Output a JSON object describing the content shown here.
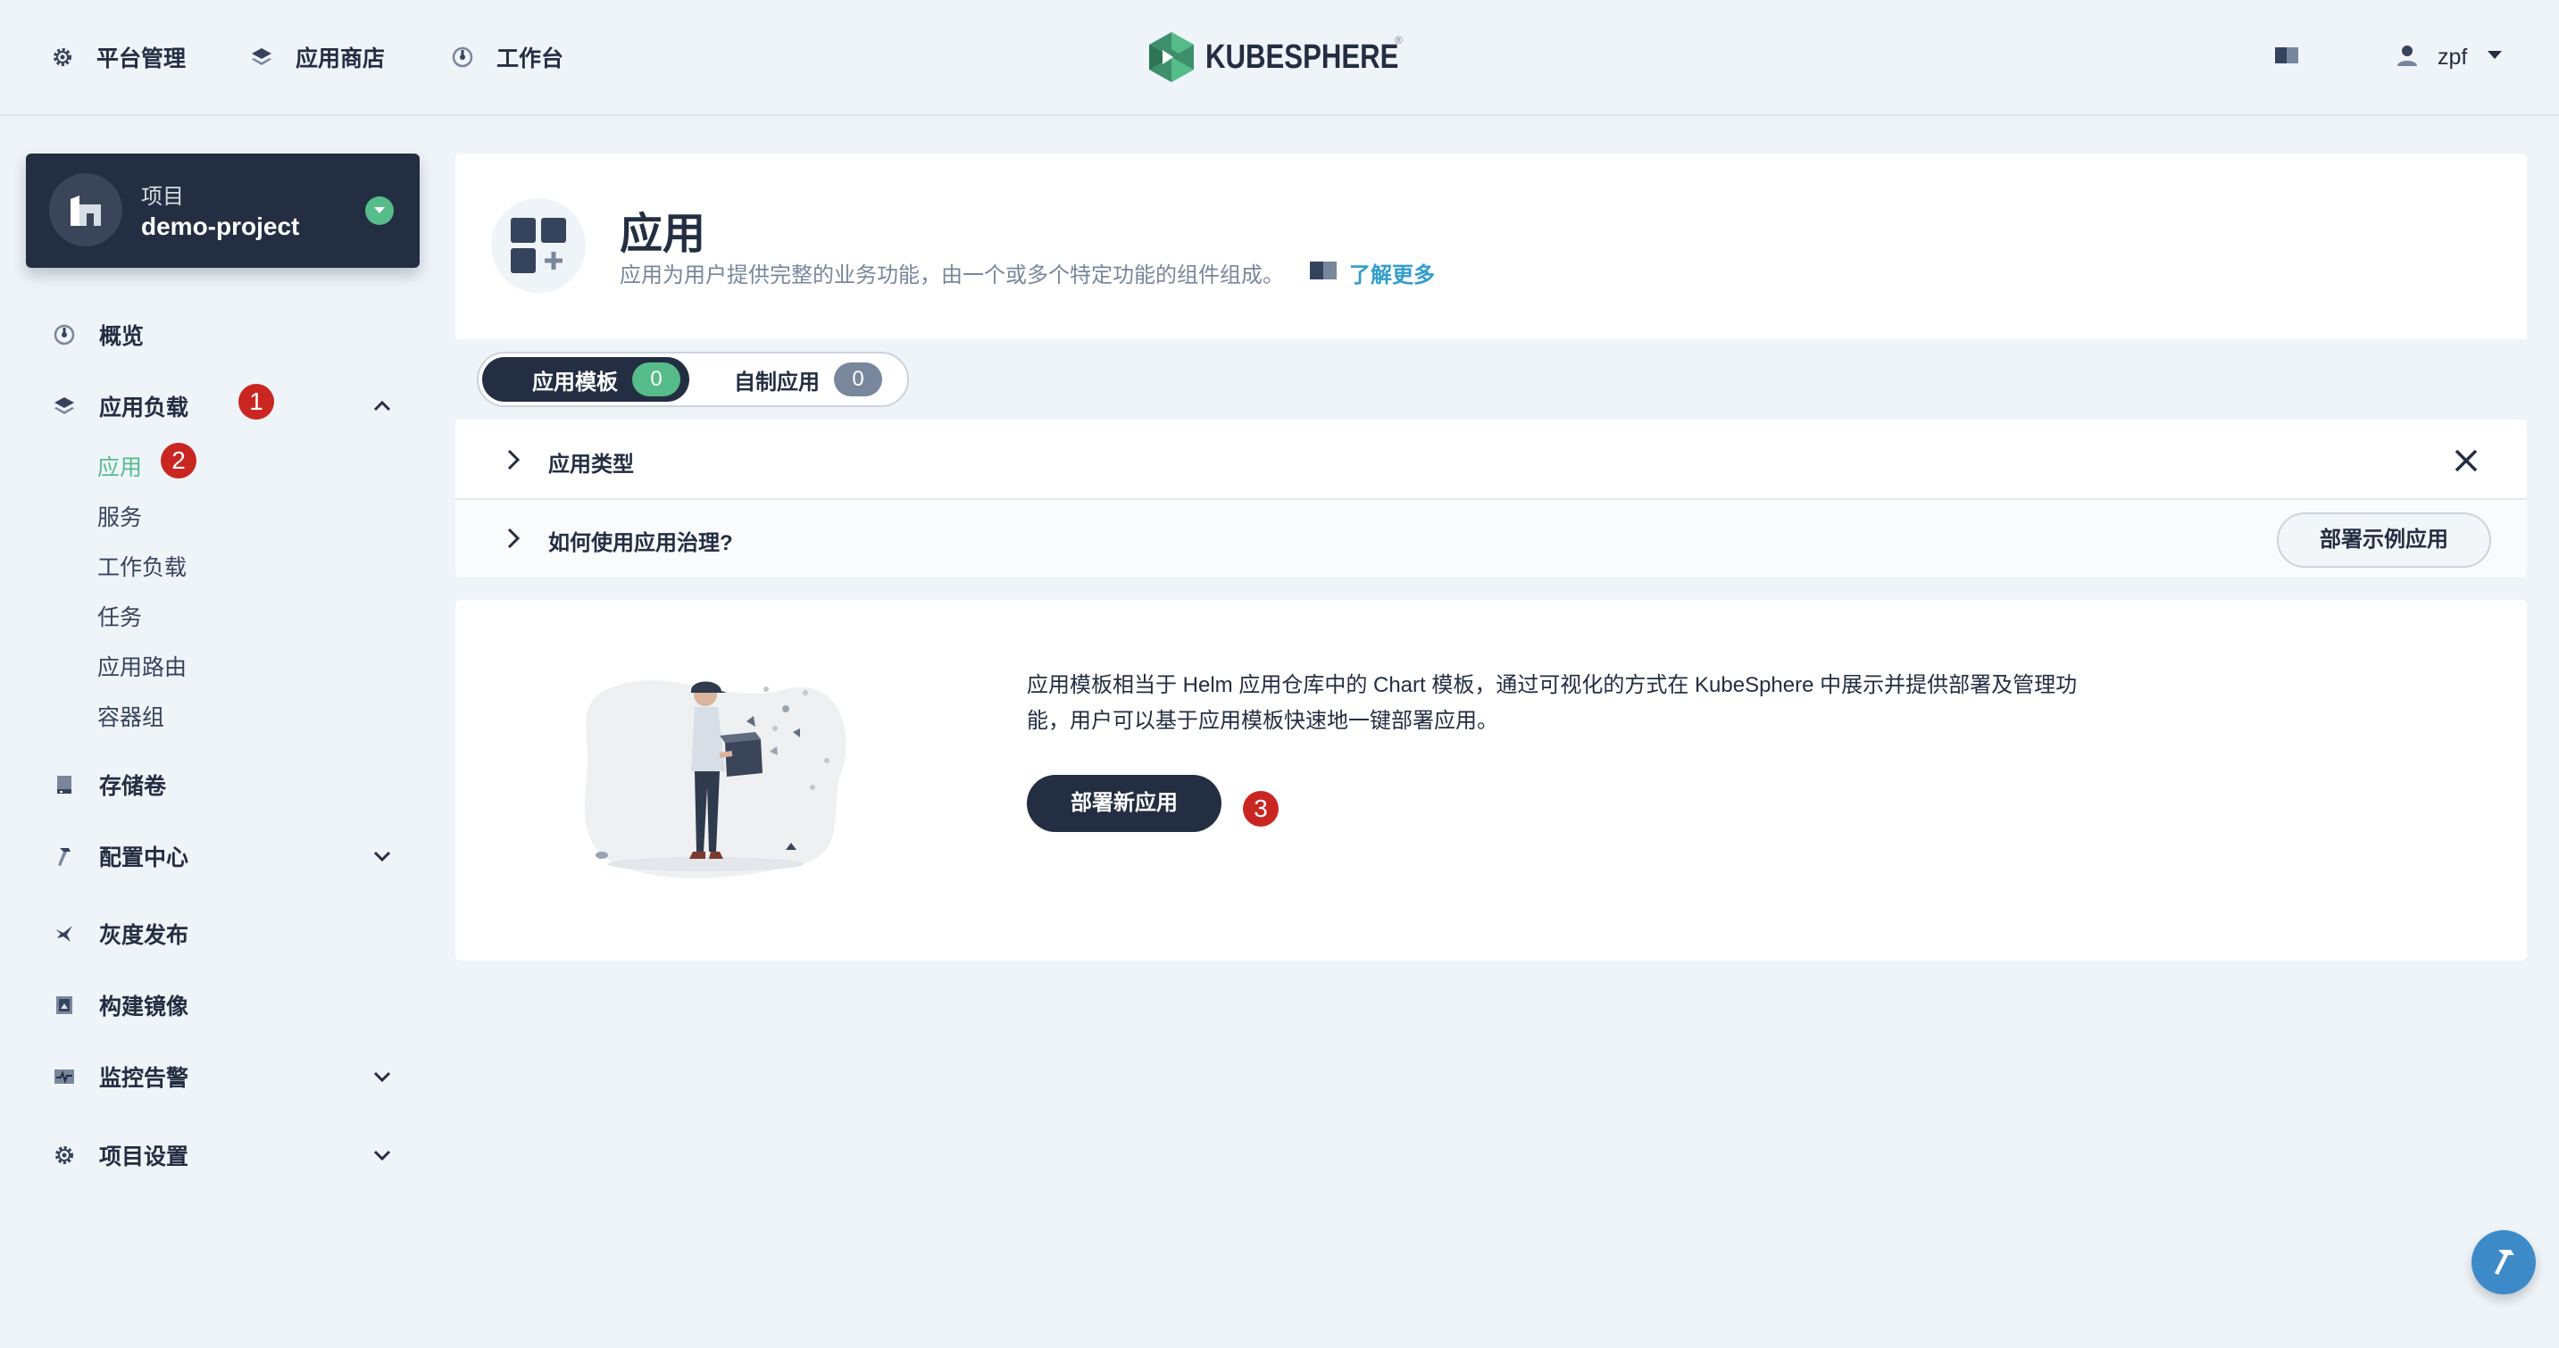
{
  "topbar": {
    "nav": [
      {
        "label": "平台管理",
        "icon": "gear-icon"
      },
      {
        "label": "应用商店",
        "icon": "layers-icon"
      },
      {
        "label": "工作台",
        "icon": "dashboard-icon"
      }
    ],
    "logo_text": "KUBESPHERE",
    "logo_mark": "®",
    "user": {
      "name": "zpf"
    }
  },
  "project": {
    "kind_label": "项目",
    "name": "demo-project"
  },
  "sidebar": {
    "items": [
      {
        "label": "概览",
        "icon": "dashboard-icon"
      },
      {
        "label": "应用负载",
        "icon": "layers-icon",
        "expanded": true,
        "children": [
          "应用",
          "服务",
          "工作负载",
          "任务",
          "应用路由",
          "容器组"
        ]
      },
      {
        "label": "存储卷",
        "icon": "storage-icon"
      },
      {
        "label": "配置中心",
        "icon": "hammer-icon"
      },
      {
        "label": "灰度发布",
        "icon": "bird-icon"
      },
      {
        "label": "构建镜像",
        "icon": "image-build-icon"
      },
      {
        "label": "监控告警",
        "icon": "monitor-icon"
      },
      {
        "label": "项目设置",
        "icon": "gear-icon"
      }
    ],
    "active_child": "应用"
  },
  "annotations": {
    "step1": "1",
    "step2": "2",
    "step3": "3"
  },
  "header": {
    "title": "应用",
    "description": "应用为用户提供完整的业务功能，由一个或多个特定功能的组件组成。",
    "learn_more": "了解更多"
  },
  "tabs": [
    {
      "label": "应用模板",
      "count": "0",
      "active": true
    },
    {
      "label": "自制应用",
      "count": "0",
      "active": false
    }
  ],
  "info_rows": {
    "app_type": "应用类型",
    "how_to": "如何使用应用治理?",
    "demo_button": "部署示例应用"
  },
  "empty_state": {
    "text": "应用模板相当于 Helm 应用仓库中的 Chart 模板，通过可视化的方式在 KubeSphere 中展示并提供部署及管理功能，用户可以基于应用模板快速地一键部署应用。",
    "button": "部署新应用"
  },
  "colors": {
    "accent": "#55bc8a",
    "dark": "#242e42",
    "badge": "#ca2621",
    "link": "#329dce"
  }
}
